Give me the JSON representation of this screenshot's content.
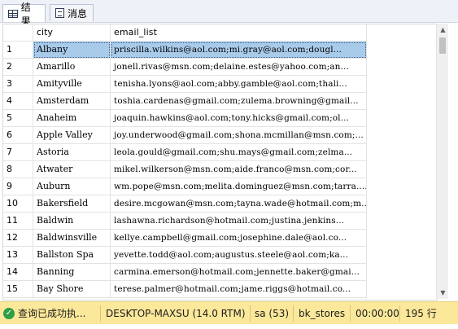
{
  "tabs": [
    {
      "label": "结果",
      "icon": "grid-icon",
      "active": true
    },
    {
      "label": "消息",
      "icon": "message-icon",
      "active": false
    }
  ],
  "columns": [
    "city",
    "email_list"
  ],
  "rows": [
    {
      "num": "1",
      "city": "Albany",
      "email": "priscilla.wilkins@aol.com;mi.gray@aol.com;dougl..."
    },
    {
      "num": "2",
      "city": "Amarillo",
      "email": "jonell.rivas@msn.com;delaine.estes@yahoo.com;an..."
    },
    {
      "num": "3",
      "city": "Amityville",
      "email": "tenisha.lyons@aol.com;abby.gamble@aol.com;thali..."
    },
    {
      "num": "4",
      "city": "Amsterdam",
      "email": "toshia.cardenas@gmail.com;zulema.browning@gmail..."
    },
    {
      "num": "5",
      "city": "Anaheim",
      "email": "joaquin.hawkins@aol.com;tony.hicks@gmail.com;ol..."
    },
    {
      "num": "6",
      "city": "Apple Valley",
      "email": "joy.underwood@gmail.com;shona.mcmillan@msn.com;..."
    },
    {
      "num": "7",
      "city": "Astoria",
      "email": "leola.gould@gmail.com;shu.mays@gmail.com;zelma..."
    },
    {
      "num": "8",
      "city": "Atwater",
      "email": "mikel.wilkerson@msn.com;aide.franco@msn.com;cor..."
    },
    {
      "num": "9",
      "city": "Auburn",
      "email": "wm.pope@msn.com;melita.dominguez@msn.com;tarra...."
    },
    {
      "num": "10",
      "city": "Bakersfield",
      "email": "desire.mcgowan@msn.com;tayna.wade@hotmail.com;m..."
    },
    {
      "num": "11",
      "city": "Baldwin",
      "email": "lashawna.richardson@hotmail.com;justina.jenkins..."
    },
    {
      "num": "12",
      "city": "Baldwinsville",
      "email": "kellye.campbell@gmail.com;josephine.dale@aol.co..."
    },
    {
      "num": "13",
      "city": "Ballston Spa",
      "email": "yevette.todd@aol.com;augustus.steele@aol.com;ka..."
    },
    {
      "num": "14",
      "city": "Banning",
      "email": "carmina.emerson@hotmail.com;jennette.baker@gmai..."
    },
    {
      "num": "15",
      "city": "Bay Shore",
      "email": "terese.palmer@hotmail.com;jame.riggs@hotmail.co..."
    }
  ],
  "selected_row": 0,
  "status": {
    "message": "查询已成功执...",
    "server": "DESKTOP-MAXSU (14.0 RTM)",
    "user": "sa (53)",
    "database": "bk_stores",
    "elapsed": "00:00:00",
    "row_count": "195 行"
  },
  "colors": {
    "status_bar": "#fbe89a",
    "selection": "#a9cbea",
    "ok": "#2f9e44"
  }
}
